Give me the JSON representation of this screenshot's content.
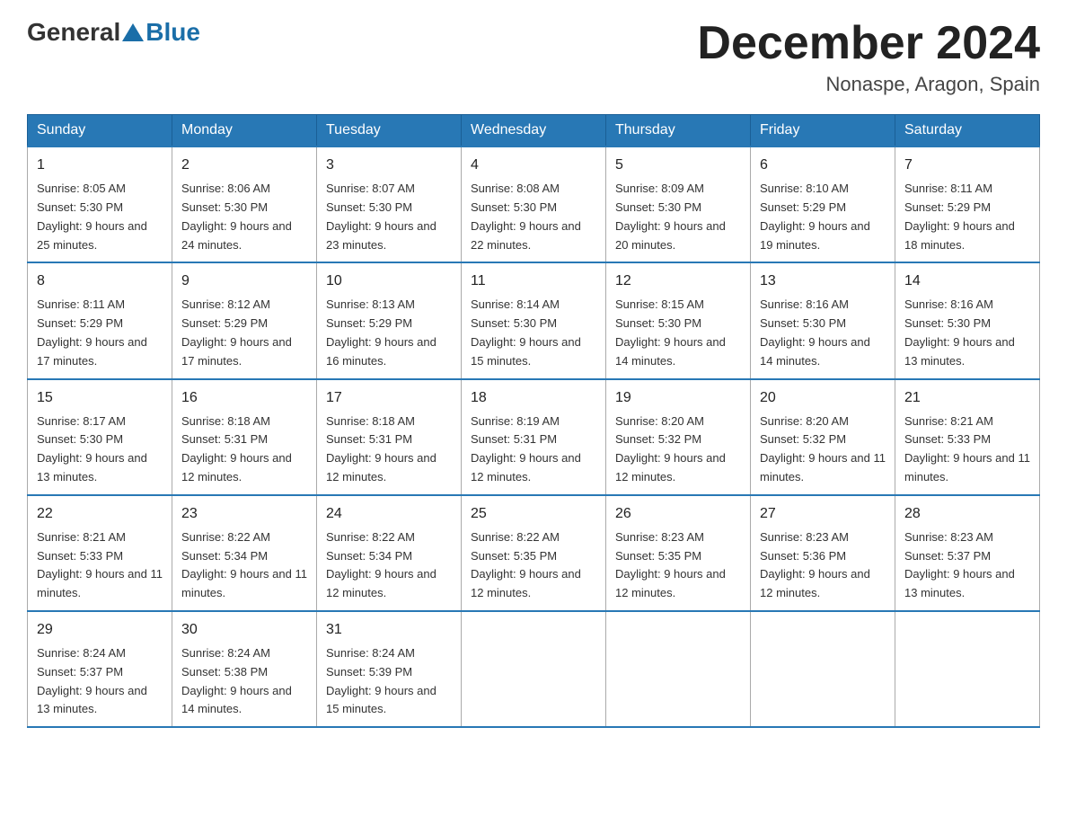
{
  "header": {
    "logo_general": "General",
    "logo_blue": "Blue",
    "month_title": "December 2024",
    "location": "Nonaspe, Aragon, Spain"
  },
  "days_of_week": [
    "Sunday",
    "Monday",
    "Tuesday",
    "Wednesday",
    "Thursday",
    "Friday",
    "Saturday"
  ],
  "weeks": [
    [
      {
        "day": "1",
        "sunrise": "8:05 AM",
        "sunset": "5:30 PM",
        "daylight": "9 hours and 25 minutes."
      },
      {
        "day": "2",
        "sunrise": "8:06 AM",
        "sunset": "5:30 PM",
        "daylight": "9 hours and 24 minutes."
      },
      {
        "day": "3",
        "sunrise": "8:07 AM",
        "sunset": "5:30 PM",
        "daylight": "9 hours and 23 minutes."
      },
      {
        "day": "4",
        "sunrise": "8:08 AM",
        "sunset": "5:30 PM",
        "daylight": "9 hours and 22 minutes."
      },
      {
        "day": "5",
        "sunrise": "8:09 AM",
        "sunset": "5:30 PM",
        "daylight": "9 hours and 20 minutes."
      },
      {
        "day": "6",
        "sunrise": "8:10 AM",
        "sunset": "5:29 PM",
        "daylight": "9 hours and 19 minutes."
      },
      {
        "day": "7",
        "sunrise": "8:11 AM",
        "sunset": "5:29 PM",
        "daylight": "9 hours and 18 minutes."
      }
    ],
    [
      {
        "day": "8",
        "sunrise": "8:11 AM",
        "sunset": "5:29 PM",
        "daylight": "9 hours and 17 minutes."
      },
      {
        "day": "9",
        "sunrise": "8:12 AM",
        "sunset": "5:29 PM",
        "daylight": "9 hours and 17 minutes."
      },
      {
        "day": "10",
        "sunrise": "8:13 AM",
        "sunset": "5:29 PM",
        "daylight": "9 hours and 16 minutes."
      },
      {
        "day": "11",
        "sunrise": "8:14 AM",
        "sunset": "5:30 PM",
        "daylight": "9 hours and 15 minutes."
      },
      {
        "day": "12",
        "sunrise": "8:15 AM",
        "sunset": "5:30 PM",
        "daylight": "9 hours and 14 minutes."
      },
      {
        "day": "13",
        "sunrise": "8:16 AM",
        "sunset": "5:30 PM",
        "daylight": "9 hours and 14 minutes."
      },
      {
        "day": "14",
        "sunrise": "8:16 AM",
        "sunset": "5:30 PM",
        "daylight": "9 hours and 13 minutes."
      }
    ],
    [
      {
        "day": "15",
        "sunrise": "8:17 AM",
        "sunset": "5:30 PM",
        "daylight": "9 hours and 13 minutes."
      },
      {
        "day": "16",
        "sunrise": "8:18 AM",
        "sunset": "5:31 PM",
        "daylight": "9 hours and 12 minutes."
      },
      {
        "day": "17",
        "sunrise": "8:18 AM",
        "sunset": "5:31 PM",
        "daylight": "9 hours and 12 minutes."
      },
      {
        "day": "18",
        "sunrise": "8:19 AM",
        "sunset": "5:31 PM",
        "daylight": "9 hours and 12 minutes."
      },
      {
        "day": "19",
        "sunrise": "8:20 AM",
        "sunset": "5:32 PM",
        "daylight": "9 hours and 12 minutes."
      },
      {
        "day": "20",
        "sunrise": "8:20 AM",
        "sunset": "5:32 PM",
        "daylight": "9 hours and 11 minutes."
      },
      {
        "day": "21",
        "sunrise": "8:21 AM",
        "sunset": "5:33 PM",
        "daylight": "9 hours and 11 minutes."
      }
    ],
    [
      {
        "day": "22",
        "sunrise": "8:21 AM",
        "sunset": "5:33 PM",
        "daylight": "9 hours and 11 minutes."
      },
      {
        "day": "23",
        "sunrise": "8:22 AM",
        "sunset": "5:34 PM",
        "daylight": "9 hours and 11 minutes."
      },
      {
        "day": "24",
        "sunrise": "8:22 AM",
        "sunset": "5:34 PM",
        "daylight": "9 hours and 12 minutes."
      },
      {
        "day": "25",
        "sunrise": "8:22 AM",
        "sunset": "5:35 PM",
        "daylight": "9 hours and 12 minutes."
      },
      {
        "day": "26",
        "sunrise": "8:23 AM",
        "sunset": "5:35 PM",
        "daylight": "9 hours and 12 minutes."
      },
      {
        "day": "27",
        "sunrise": "8:23 AM",
        "sunset": "5:36 PM",
        "daylight": "9 hours and 12 minutes."
      },
      {
        "day": "28",
        "sunrise": "8:23 AM",
        "sunset": "5:37 PM",
        "daylight": "9 hours and 13 minutes."
      }
    ],
    [
      {
        "day": "29",
        "sunrise": "8:24 AM",
        "sunset": "5:37 PM",
        "daylight": "9 hours and 13 minutes."
      },
      {
        "day": "30",
        "sunrise": "8:24 AM",
        "sunset": "5:38 PM",
        "daylight": "9 hours and 14 minutes."
      },
      {
        "day": "31",
        "sunrise": "8:24 AM",
        "sunset": "5:39 PM",
        "daylight": "9 hours and 15 minutes."
      },
      null,
      null,
      null,
      null
    ]
  ]
}
